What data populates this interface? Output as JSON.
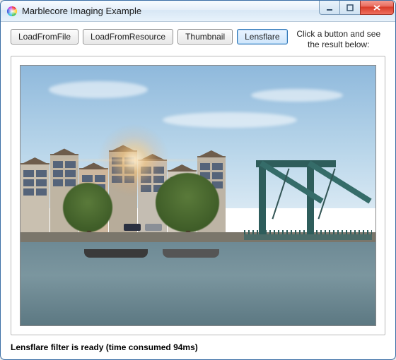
{
  "window": {
    "title": "Marblecore Imaging Example",
    "icon": "color-wheel-icon"
  },
  "toolbar": {
    "buttons": [
      {
        "id": "load-file",
        "label": "LoadFromFile",
        "active": false
      },
      {
        "id": "load-resource",
        "label": "LoadFromResource",
        "active": false
      },
      {
        "id": "thumbnail",
        "label": "Thumbnail",
        "active": false
      },
      {
        "id": "lensflare",
        "label": "Lensflare",
        "active": true
      }
    ],
    "hint": "Click a button and see the result below:"
  },
  "image": {
    "description": "Canal scene with row of gabled buildings, trees, parked cars, moored boats, and a green bascule drawbridge; lens-flare overlay upper-left.",
    "has_lensflare": true
  },
  "status": {
    "prefix": "Lensflare filter is ready (time consumed ",
    "time_ms": "94ms",
    "suffix": ")"
  },
  "win_controls": {
    "minimize": "minimize-icon",
    "maximize": "maximize-icon",
    "close": "close-icon"
  }
}
